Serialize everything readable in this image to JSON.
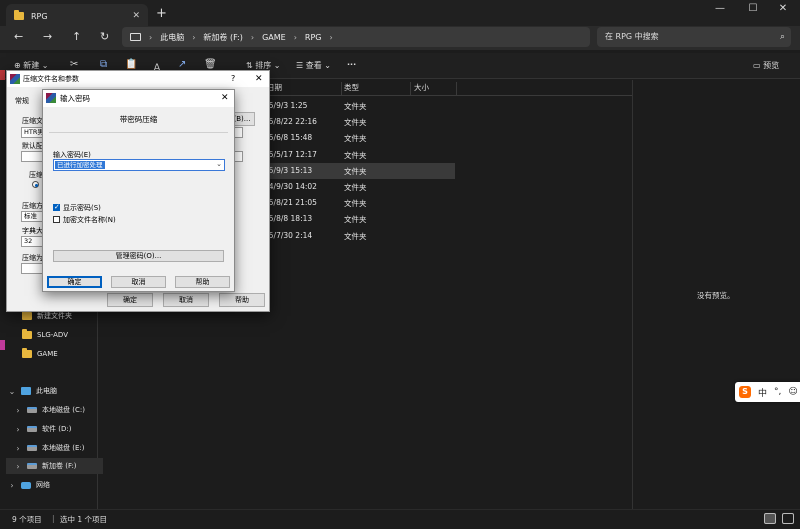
{
  "window": {
    "tab_title": "RPG",
    "new_tab": "+",
    "minimize": "—",
    "maximize": "☐",
    "close": "✕"
  },
  "nav": {
    "back": "←",
    "forward": "→",
    "up": "↑",
    "refresh": "↻",
    "breadcrumbs": [
      "此电脑",
      "新加卷 (F:)",
      "GAME",
      "RPG"
    ],
    "search_placeholder": "在 RPG 中搜索"
  },
  "commandbar": {
    "new_label": "新建",
    "sort_label": "排序",
    "view_label": "查看",
    "more": "···",
    "preview_label": "预览"
  },
  "columns": [
    "日期",
    "类型",
    "大小"
  ],
  "files": [
    {
      "date": "25/9/3 1:25",
      "type": "文件夹"
    },
    {
      "date": "25/8/22 22:16",
      "type": "文件夹"
    },
    {
      "date": "25/6/8 15:48",
      "type": "文件夹"
    },
    {
      "date": "25/5/17 12:17",
      "type": "文件夹"
    },
    {
      "date": "25/9/3 15:13",
      "type": "文件夹"
    },
    {
      "date": "24/9/30 14:02",
      "type": "文件夹"
    },
    {
      "date": "25/8/21 21:05",
      "type": "文件夹"
    },
    {
      "date": "25/8/8 18:13",
      "type": "文件夹"
    },
    {
      "date": "25/7/30 2:14",
      "type": "文件夹"
    }
  ],
  "preview_empty": "没有预览。",
  "sidebar": {
    "quick": [
      "新建文件夹",
      "SLG-ADV",
      "GAME"
    ],
    "this_pc": "此电脑",
    "drives": [
      "本地磁盘 (C:)",
      "软件 (D:)",
      "本地磁盘 (E:)",
      "新加卷 (F:)"
    ],
    "network": "网络"
  },
  "status": {
    "count": "9 个项目",
    "selection": "选中 1 个项目"
  },
  "ime": {
    "brand": "S",
    "mode": "中",
    "punct": "°,",
    "extra": "☺"
  },
  "archive_dialog": {
    "title": "压缩文件名和参数",
    "help_icon": "?",
    "close": "✕",
    "tab_general": "常规",
    "name_label": "压缩文",
    "name_value": "HTR男...",
    "browse": "浏览(B)...",
    "profile_label": "默认配",
    "format_label": "压缩",
    "method_label": "压缩方",
    "method_value": "标准",
    "dict_label": "字典大",
    "dict_value": "32",
    "split_label": "压缩为",
    "ok": "确定",
    "cancel": "取消",
    "help": "帮助"
  },
  "password_dialog": {
    "title": "输入密码",
    "close": "✕",
    "subtitle": "带密码压缩",
    "enter_label": "输入密码(E)",
    "password_value": "已进行加密处理",
    "show_password": "显示密码(S)",
    "show_password_checked": true,
    "encrypt_names": "加密文件名称(N)",
    "encrypt_names_checked": false,
    "manage": "管理密码(O)...",
    "ok": "确定",
    "cancel": "取消",
    "help": "帮助"
  }
}
